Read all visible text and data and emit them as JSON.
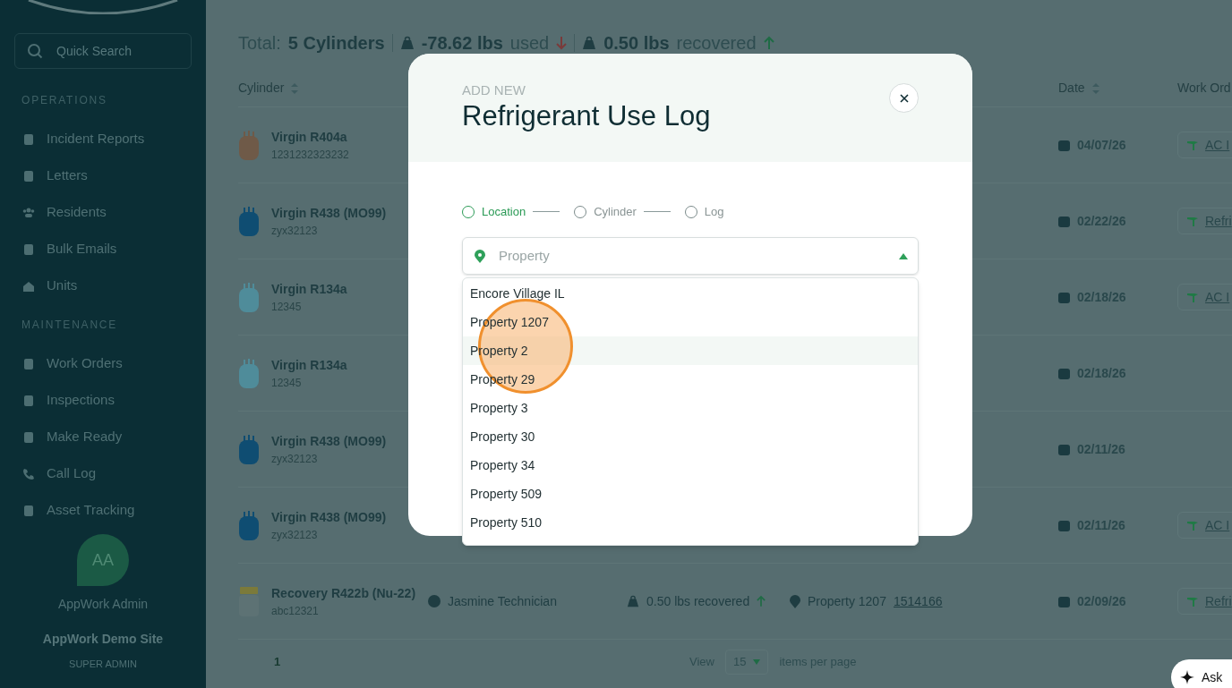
{
  "sidebar": {
    "search": {
      "placeholder": "Quick Search"
    },
    "sections": [
      {
        "title": "OPERATIONS",
        "items": [
          {
            "label": "Incident Reports"
          },
          {
            "label": "Letters"
          },
          {
            "label": "Residents"
          },
          {
            "label": "Bulk Emails"
          },
          {
            "label": "Units"
          }
        ]
      },
      {
        "title": "MAINTENANCE",
        "items": [
          {
            "label": "Work Orders"
          },
          {
            "label": "Inspections"
          },
          {
            "label": "Make Ready"
          },
          {
            "label": "Call Log"
          },
          {
            "label": "Asset Tracking"
          }
        ]
      }
    ],
    "user": {
      "initials": "AA",
      "name": "AppWork Admin",
      "site": "AppWork Demo Site",
      "role": "SUPER ADMIN"
    }
  },
  "summary": {
    "label": "Total:",
    "count": "5 Cylinders",
    "used": "-78.62 lbs",
    "used_word": "used",
    "recovered": "0.50 lbs",
    "recovered_word": "recovered"
  },
  "table": {
    "columns": [
      "Cylinder",
      "Date",
      "Work Ord"
    ],
    "rows": [
      {
        "kind": "virgin",
        "color": "#6f5a48",
        "name": "Virgin R404a",
        "code": "1231232323232",
        "date": "04/07/26",
        "work_order": "AC I"
      },
      {
        "kind": "virgin",
        "color": "#0f4d72",
        "name": "Virgin R438 (MO99)",
        "code": "zyx32123",
        "date": "02/22/26",
        "work_order": "Refri"
      },
      {
        "kind": "virgin",
        "color": "#4f8c9a",
        "name": "Virgin R134a",
        "code": "12345",
        "date": "02/18/26",
        "work_order": "AC I"
      },
      {
        "kind": "virgin",
        "color": "#4f8c9a",
        "name": "Virgin R134a",
        "code": "12345",
        "date": "02/18/26"
      },
      {
        "kind": "virgin",
        "color": "#0f4d72",
        "name": "Virgin R438 (MO99)",
        "code": "zyx32123",
        "date": "02/11/26"
      },
      {
        "kind": "virgin",
        "color": "#0f4d72",
        "name": "Virgin R438 (MO99)",
        "code": "zyx32123",
        "date": "02/11/26",
        "work_order": "AC I"
      },
      {
        "kind": "recovery",
        "color": "#5d7274",
        "name": "Recovery R422b (Nu-22)",
        "code": "abc12321",
        "technician": "Jasmine Technician",
        "amount": "0.50 lbs recovered",
        "property": "Property 1207",
        "property_link": "1514166",
        "date": "02/09/26",
        "work_order": "Refri"
      }
    ]
  },
  "pagination": {
    "page": "1",
    "view": "View",
    "per_page": "15",
    "suffix": "items per page"
  },
  "modal": {
    "eyebrow": "ADD NEW",
    "title": "Refrigerant Use Log",
    "steps": [
      {
        "label": "Location",
        "selected": true
      },
      {
        "label": "Cylinder",
        "selected": false
      },
      {
        "label": "Log",
        "selected": false
      }
    ],
    "select": {
      "placeholder": "Property",
      "expanded": true
    },
    "options": [
      {
        "label": "Encore Village IL",
        "highlighted": false
      },
      {
        "label": "Property 1207",
        "highlighted": false
      },
      {
        "label": "Property 2",
        "highlighted": true
      },
      {
        "label": "Property 29",
        "highlighted": false
      },
      {
        "label": "Property 3",
        "highlighted": false
      },
      {
        "label": "Property 30",
        "highlighted": false
      },
      {
        "label": "Property 34",
        "highlighted": false
      },
      {
        "label": "Property 509",
        "highlighted": false
      },
      {
        "label": "Property 510",
        "highlighted": false
      }
    ]
  },
  "assistant": {
    "label": "Ask"
  }
}
